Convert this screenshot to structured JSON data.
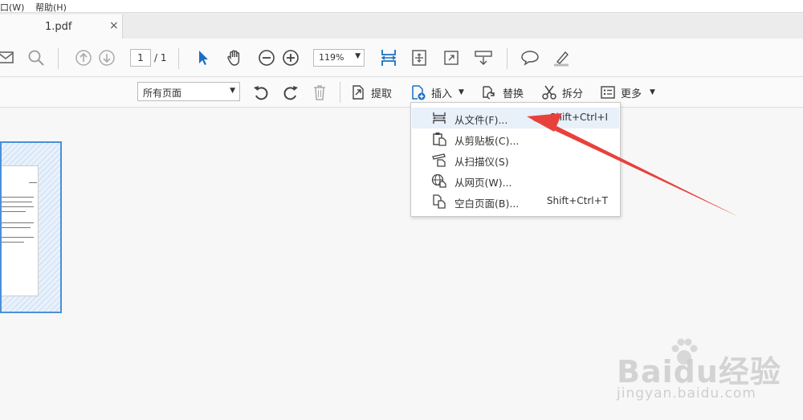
{
  "menubar": {
    "window_label": "口(W)",
    "help_label": "帮助(H)"
  },
  "tab": {
    "name": "1.pdf",
    "close": "×"
  },
  "toolbar": {
    "page_current": "1",
    "page_total": "/ 1",
    "zoom": "119%",
    "zoom_caret": "▼"
  },
  "toolbar2": {
    "page_range": "所有页面",
    "page_range_caret": "▼",
    "extract": "提取",
    "insert": "插入",
    "insert_caret": "▼",
    "replace": "替换",
    "split": "拆分",
    "more": "更多",
    "more_caret": "▼"
  },
  "dropdown": {
    "items": [
      {
        "label": "从文件(F)...",
        "shortcut": "Shift+Ctrl+I",
        "icon": "from-file-icon"
      },
      {
        "label": "从剪贴板(C)...",
        "shortcut": "",
        "icon": "clipboard-icon"
      },
      {
        "label": "从扫描仪(S)",
        "shortcut": "",
        "icon": "scanner-icon"
      },
      {
        "label": "从网页(W)...",
        "shortcut": "",
        "icon": "web-page-icon"
      },
      {
        "label": "空白页面(B)...",
        "shortcut": "Shift+Ctrl+T",
        "icon": "blank-page-icon"
      }
    ]
  },
  "watermark": {
    "brand": "Baidu经验",
    "url": "jingyan.baidu.com"
  },
  "colors": {
    "accent": "#1a6fc4",
    "arrow": "#e8413c",
    "selection": "#e8f0fa",
    "thumb_border": "#4a90d9"
  }
}
